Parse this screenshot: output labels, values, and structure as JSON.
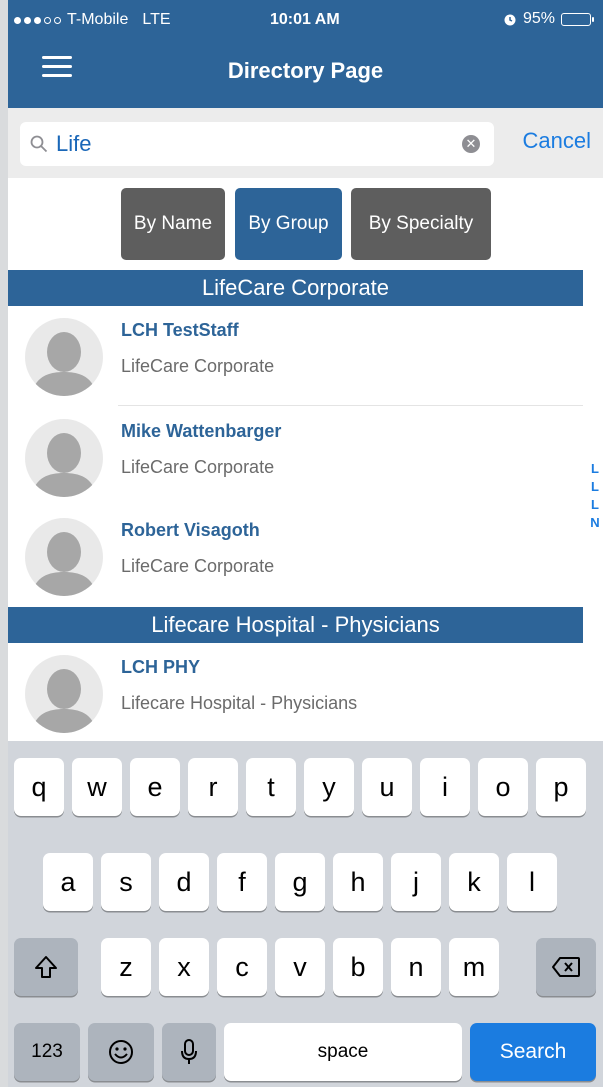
{
  "status_bar": {
    "carrier": "T-Mobile",
    "network": "LTE",
    "time": "10:01 AM",
    "battery": "95%",
    "battery_level": 0.95,
    "alarm_icon": "alarm-clock-icon"
  },
  "nav": {
    "title": "Directory Page",
    "menu_icon": "hamburger-icon"
  },
  "search": {
    "value": "Life",
    "cancel_label": "Cancel"
  },
  "filters": [
    {
      "label": "By Name",
      "active": false
    },
    {
      "label": "By Group",
      "active": true
    },
    {
      "label": "By Specialty",
      "active": false
    }
  ],
  "sections": [
    {
      "title": "LifeCare Corporate",
      "rows": [
        {
          "name": "LCH TestStaff",
          "group": "LifeCare Corporate"
        },
        {
          "name": "Mike Wattenbarger",
          "group": "LifeCare Corporate"
        },
        {
          "name": "Robert Visagoth",
          "group": "LifeCare Corporate"
        }
      ]
    },
    {
      "title": "Lifecare Hospital - Physicians",
      "rows": [
        {
          "name": "LCH PHY",
          "group": "Lifecare Hospital - Physicians"
        }
      ]
    }
  ],
  "section_index": [
    "L",
    "L",
    "L",
    "N"
  ],
  "keyboard": {
    "row1": [
      "q",
      "w",
      "e",
      "r",
      "t",
      "y",
      "u",
      "i",
      "o",
      "p"
    ],
    "row2": [
      "a",
      "s",
      "d",
      "f",
      "g",
      "h",
      "j",
      "k",
      "l"
    ],
    "row3": [
      "z",
      "x",
      "c",
      "v",
      "b",
      "n",
      "m"
    ],
    "numbers_label": "123",
    "space_label": "space",
    "search_label": "Search"
  },
  "colors": {
    "brand": "#2d6498",
    "accent": "#1b7ce0",
    "filter_inactive": "#5e5e5e"
  }
}
